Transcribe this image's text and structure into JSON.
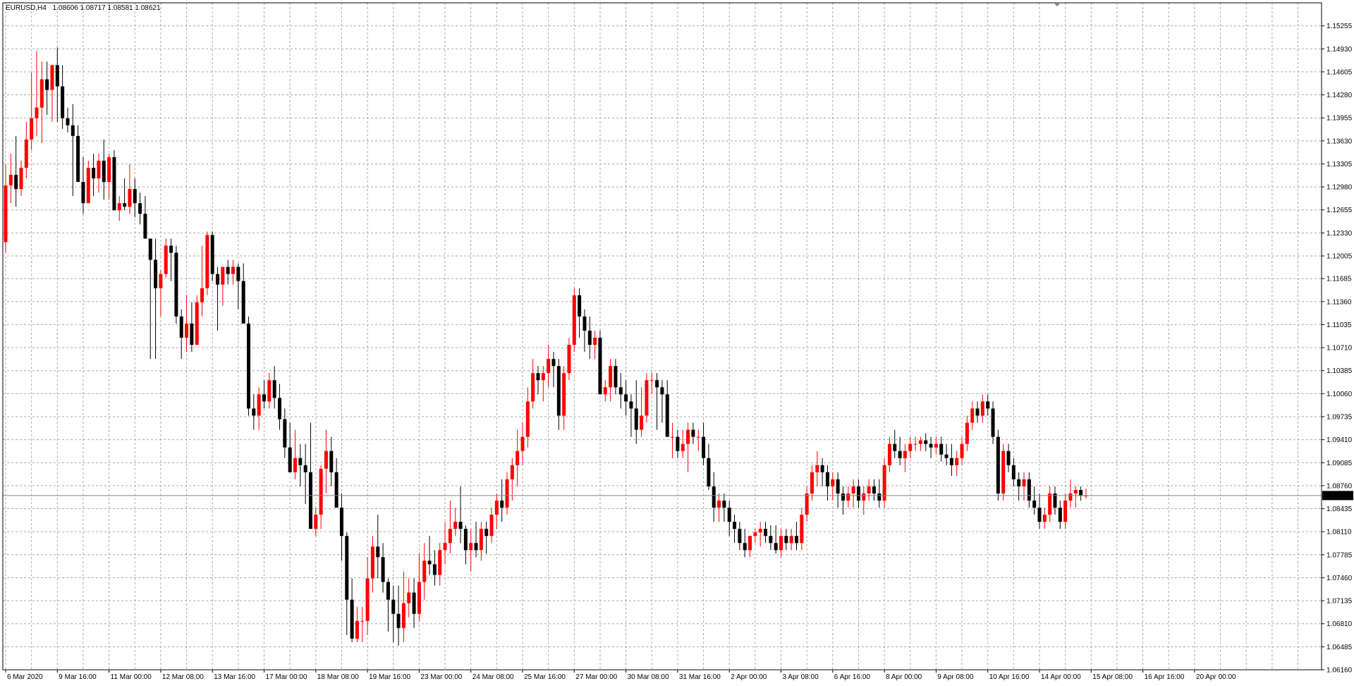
{
  "header": {
    "symbol_tf": "EURUSD,H4",
    "quote": "1.08606 1.08717 1.08581 1.08621"
  },
  "current_price": {
    "label": "1.08621",
    "value": 1.08621,
    "bg": "#000000",
    "fg": "#ffffff",
    "line_color": "#778899"
  },
  "colors": {
    "bull": "#ff0000",
    "bear": "#000000",
    "doji": "#00ff00",
    "grid": "#a9a9a9",
    "background": "#ffffff",
    "frame": "#000000"
  },
  "chart_data": {
    "type": "candlestick",
    "symbol": "EURUSD",
    "timeframe": "H4",
    "ylim": [
      1.0616,
      1.1558
    ],
    "grid": true,
    "y_ticks": [
      "1.15255",
      "1.14930",
      "1.14605",
      "1.14280",
      "1.13955",
      "1.13630",
      "1.13305",
      "1.12980",
      "1.12655",
      "1.12330",
      "1.12005",
      "1.11685",
      "1.11360",
      "1.11035",
      "1.10710",
      "1.10385",
      "1.10060",
      "1.09735",
      "1.09410",
      "1.09085",
      "1.08760",
      "1.08435",
      "1.08110",
      "1.07785",
      "1.07460",
      "1.07135",
      "1.06810",
      "1.06485",
      "1.06160"
    ],
    "x_ticks": [
      "6 Mar 2020",
      "9 Mar 16:00",
      "11 Mar 00:00",
      "12 Mar 08:00",
      "13 Mar 16:00",
      "17 Mar 00:00",
      "18 Mar 08:00",
      "19 Mar 16:00",
      "23 Mar 00:00",
      "24 Mar 08:00",
      "25 Mar 16:00",
      "27 Mar 00:00",
      "30 Mar 08:00",
      "31 Mar 16:00",
      "2 Apr 00:00",
      "3 Apr 08:00",
      "6 Apr 16:00",
      "8 Apr 00:00",
      "9 Apr 08:00",
      "10 Apr 16:00",
      "14 Apr 00:00",
      "15 Apr 08:00",
      "16 Apr 16:00",
      "20 Apr 00:00"
    ],
    "x_tick_index": [
      0,
      10,
      20,
      30,
      40,
      50,
      60,
      70,
      80,
      90,
      100,
      110,
      120,
      130,
      140,
      150,
      160,
      170,
      180,
      190,
      200,
      210,
      220,
      230
    ],
    "candles": [
      [
        1.122,
        1.133,
        1.1205,
        1.13
      ],
      [
        1.13,
        1.1345,
        1.1275,
        1.1315
      ],
      [
        1.1315,
        1.137,
        1.127,
        1.1295
      ],
      [
        1.1295,
        1.1335,
        1.1285,
        1.1325
      ],
      [
        1.1325,
        1.139,
        1.131,
        1.1365
      ],
      [
        1.1365,
        1.146,
        1.135,
        1.1395
      ],
      [
        1.1395,
        1.149,
        1.137,
        1.141
      ],
      [
        1.141,
        1.1475,
        1.136,
        1.145
      ],
      [
        1.145,
        1.1475,
        1.14,
        1.1435
      ],
      [
        1.1435,
        1.1465,
        1.139,
        1.147
      ],
      [
        1.147,
        1.1495,
        1.139,
        1.144
      ],
      [
        1.144,
        1.147,
        1.138,
        1.1395
      ],
      [
        1.1395,
        1.141,
        1.1375,
        1.1385
      ],
      [
        1.1385,
        1.1415,
        1.1285,
        1.137
      ],
      [
        1.137,
        1.1385,
        1.133,
        1.1305
      ],
      [
        1.1305,
        1.134,
        1.126,
        1.1275
      ],
      [
        1.1275,
        1.1335,
        1.128,
        1.1325
      ],
      [
        1.1325,
        1.1345,
        1.1285,
        1.131
      ],
      [
        1.131,
        1.1345,
        1.129,
        1.1335
      ],
      [
        1.1335,
        1.1365,
        1.128,
        1.1305
      ],
      [
        1.1305,
        1.1345,
        1.128,
        1.134
      ],
      [
        1.134,
        1.135,
        1.1265,
        1.1265
      ],
      [
        1.1265,
        1.1285,
        1.125,
        1.1275
      ],
      [
        1.1275,
        1.131,
        1.1265,
        1.127
      ],
      [
        1.127,
        1.133,
        1.126,
        1.1295
      ],
      [
        1.1295,
        1.131,
        1.1255,
        1.1275
      ],
      [
        1.1275,
        1.129,
        1.1245,
        1.126
      ],
      [
        1.126,
        1.1285,
        1.1225,
        1.1225
      ],
      [
        1.1225,
        1.122,
        1.1055,
        1.1195
      ],
      [
        1.1195,
        1.1225,
        1.1055,
        1.1155
      ],
      [
        1.1155,
        1.118,
        1.1115,
        1.1175
      ],
      [
        1.1175,
        1.1225,
        1.117,
        1.1215
      ],
      [
        1.1215,
        1.1225,
        1.1165,
        1.1205
      ],
      [
        1.1205,
        1.1215,
        1.1105,
        1.1115
      ],
      [
        1.1115,
        1.1125,
        1.1055,
        1.1085
      ],
      [
        1.1085,
        1.1145,
        1.1065,
        1.1105
      ],
      [
        1.1105,
        1.1135,
        1.1065,
        1.1075
      ],
      [
        1.1075,
        1.1145,
        1.1075,
        1.1135
      ],
      [
        1.1135,
        1.1215,
        1.1115,
        1.1155
      ],
      [
        1.1155,
        1.1235,
        1.1145,
        1.123
      ],
      [
        1.123,
        1.1235,
        1.1165,
        1.1175
      ],
      [
        1.1175,
        1.1185,
        1.1095,
        1.116
      ],
      [
        1.116,
        1.1185,
        1.113,
        1.1185
      ],
      [
        1.1185,
        1.1195,
        1.116,
        1.1175
      ],
      [
        1.1175,
        1.1195,
        1.116,
        1.1185
      ],
      [
        1.1185,
        1.119,
        1.1125,
        1.1165
      ],
      [
        1.1165,
        1.119,
        1.1135,
        1.1105
      ],
      [
        1.1105,
        1.1115,
        1.0975,
        1.0985
      ],
      [
        1.0985,
        1.1005,
        1.0955,
        1.0975
      ],
      [
        1.0975,
        1.1015,
        1.0955,
        1.1005
      ],
      [
        1.1005,
        1.1025,
        1.0985,
        1.0995
      ],
      [
        1.0995,
        1.1035,
        1.0985,
        1.1025
      ],
      [
        1.1025,
        1.1045,
        1.0985,
        1.1
      ],
      [
        1.1,
        1.102,
        1.0955,
        1.097
      ],
      [
        1.097,
        1.0985,
        1.0915,
        1.093
      ],
      [
        1.093,
        1.0965,
        1.0915,
        1.0895
      ],
      [
        1.0895,
        1.0955,
        1.0885,
        1.0915
      ],
      [
        1.0915,
        1.0935,
        1.0875,
        1.0905
      ],
      [
        1.0905,
        1.0935,
        1.085,
        1.0895
      ],
      [
        1.0895,
        1.0965,
        1.083,
        1.0815
      ],
      [
        1.0815,
        1.0845,
        1.0805,
        1.0835
      ],
      [
        1.0835,
        1.0905,
        1.0815,
        1.09
      ],
      [
        1.09,
        1.0955,
        1.0865,
        1.0925
      ],
      [
        1.0925,
        1.0945,
        1.0875,
        1.0895
      ],
      [
        1.0895,
        1.0915,
        1.0855,
        1.0845
      ],
      [
        1.0845,
        1.0865,
        1.077,
        1.0805
      ],
      [
        1.0805,
        1.081,
        1.0665,
        1.0715
      ],
      [
        1.0715,
        1.0745,
        1.0655,
        1.066
      ],
      [
        1.066,
        1.0705,
        1.0655,
        1.0685
      ],
      [
        1.0685,
        1.0705,
        1.0655,
        1.0685
      ],
      [
        1.0685,
        1.0775,
        1.0665,
        1.0745
      ],
      [
        1.0745,
        1.0805,
        1.0725,
        1.079
      ],
      [
        1.079,
        1.0835,
        1.0745,
        1.0775
      ],
      [
        1.0775,
        1.0795,
        1.0725,
        1.074
      ],
      [
        1.074,
        1.0745,
        1.067,
        1.0715
      ],
      [
        1.0715,
        1.0735,
        1.0655,
        1.0695
      ],
      [
        1.0695,
        1.0735,
        1.065,
        1.0675
      ],
      [
        1.0675,
        1.0755,
        1.0655,
        1.071
      ],
      [
        1.071,
        1.0745,
        1.069,
        1.0725
      ],
      [
        1.0725,
        1.0745,
        1.0675,
        1.0695
      ],
      [
        1.0695,
        1.078,
        1.0685,
        1.074
      ],
      [
        1.074,
        1.0795,
        1.0715,
        1.077
      ],
      [
        1.077,
        1.0805,
        1.075,
        1.0765
      ],
      [
        1.0765,
        1.0785,
        1.0735,
        1.075
      ],
      [
        1.075,
        1.0795,
        1.0735,
        1.0785
      ],
      [
        1.0785,
        1.0825,
        1.0765,
        1.0795
      ],
      [
        1.0795,
        1.0855,
        1.078,
        1.0815
      ],
      [
        1.0815,
        1.0845,
        1.0805,
        1.0825
      ],
      [
        1.0825,
        1.0875,
        1.0795,
        1.0815
      ],
      [
        1.0815,
        1.082,
        1.0765,
        1.0785
      ],
      [
        1.0785,
        1.0815,
        1.0755,
        1.0795
      ],
      [
        1.0795,
        1.0825,
        1.0775,
        1.0785
      ],
      [
        1.0785,
        1.0825,
        1.077,
        1.0815
      ],
      [
        1.0815,
        1.0825,
        1.078,
        1.0805
      ],
      [
        1.0805,
        1.0845,
        1.0795,
        1.0835
      ],
      [
        1.0835,
        1.0865,
        1.0815,
        1.0855
      ],
      [
        1.0855,
        1.0885,
        1.0825,
        1.0845
      ],
      [
        1.0845,
        1.0895,
        1.0835,
        1.0885
      ],
      [
        1.0885,
        1.0915,
        1.0855,
        1.0905
      ],
      [
        1.0905,
        1.0955,
        1.0875,
        1.0925
      ],
      [
        1.0925,
        1.0965,
        1.0905,
        1.0945
      ],
      [
        1.0945,
        1.1015,
        1.093,
        1.0995
      ],
      [
        1.0995,
        1.1055,
        1.0985,
        1.1035
      ],
      [
        1.1035,
        1.1045,
        1.1005,
        1.1025
      ],
      [
        1.1025,
        1.1045,
        1.0995,
        1.1035
      ],
      [
        1.1035,
        1.1075,
        1.1015,
        1.1055
      ],
      [
        1.1055,
        1.1065,
        1.1015,
        1.1045
      ],
      [
        1.1045,
        1.1055,
        1.0955,
        1.0975
      ],
      [
        1.0975,
        1.1045,
        1.0955,
        1.1035
      ],
      [
        1.1035,
        1.1085,
        1.1025,
        1.1075
      ],
      [
        1.1075,
        1.1155,
        1.1065,
        1.1145
      ],
      [
        1.1145,
        1.1155,
        1.1085,
        1.1115
      ],
      [
        1.1115,
        1.1125,
        1.1065,
        1.1095
      ],
      [
        1.1095,
        1.1115,
        1.1055,
        1.1075
      ],
      [
        1.1075,
        1.1095,
        1.1055,
        1.1085
      ],
      [
        1.1085,
        1.1095,
        1.1045,
        1.1005
      ],
      [
        1.1005,
        1.1025,
        1.0995,
        1.1015
      ],
      [
        1.1015,
        1.1055,
        1.0995,
        1.1045
      ],
      [
        1.1045,
        1.1055,
        1.1005,
        1.1015
      ],
      [
        1.1015,
        1.1035,
        1.0985,
        1.1005
      ],
      [
        1.1005,
        1.1025,
        1.0975,
        1.0995
      ],
      [
        1.0995,
        1.1005,
        1.0945,
        1.0985
      ],
      [
        1.0985,
        1.1025,
        1.0935,
        1.0955
      ],
      [
        1.0955,
        1.1015,
        1.0945,
        1.0975
      ],
      [
        1.0975,
        1.1035,
        1.0965,
        1.1025
      ],
      [
        1.1025,
        1.1035,
        1.1005,
        1.1025
      ],
      [
        1.1025,
        1.1035,
        1.0955,
        1.1015
      ],
      [
        1.1015,
        1.1025,
        1.0965,
        1.1005
      ],
      [
        1.1005,
        1.1025,
        1.0945,
        1.0945
      ],
      [
        1.0945,
        1.0965,
        1.0915,
        1.0945
      ],
      [
        1.0945,
        1.0955,
        1.0915,
        1.0925
      ],
      [
        1.0925,
        1.0955,
        1.0915,
        1.0935
      ],
      [
        1.0935,
        1.0965,
        1.0895,
        1.0955
      ],
      [
        1.0955,
        1.0965,
        1.0935,
        1.0945
      ],
      [
        1.0945,
        1.0955,
        1.0925,
        1.0945
      ],
      [
        1.0945,
        1.0965,
        1.0905,
        1.0915
      ],
      [
        1.0915,
        1.0935,
        1.087,
        1.0875
      ],
      [
        1.0875,
        1.0895,
        1.0825,
        1.0845
      ],
      [
        1.0845,
        1.0865,
        1.0825,
        1.0855
      ],
      [
        1.0855,
        1.0865,
        1.0825,
        1.0845
      ],
      [
        1.0845,
        1.0855,
        1.0805,
        1.0825
      ],
      [
        1.0825,
        1.0835,
        1.0795,
        1.0815
      ],
      [
        1.0815,
        1.0825,
        1.0785,
        1.0795
      ],
      [
        1.0795,
        1.0815,
        1.0775,
        1.0785
      ],
      [
        1.0785,
        1.0805,
        1.0775,
        1.0805
      ],
      [
        1.0805,
        1.0815,
        1.0795,
        1.081
      ],
      [
        1.081,
        1.0825,
        1.079,
        1.0815
      ],
      [
        1.0815,
        1.0825,
        1.0795,
        1.0805
      ],
      [
        1.0805,
        1.082,
        1.0785,
        1.0795
      ],
      [
        1.0795,
        1.082,
        1.078,
        1.0785
      ],
      [
        1.0785,
        1.0815,
        1.0775,
        1.0805
      ],
      [
        1.0805,
        1.0815,
        1.0785,
        1.0795
      ],
      [
        1.0795,
        1.0815,
        1.0785,
        1.0805
      ],
      [
        1.0805,
        1.0825,
        1.0785,
        1.0795
      ],
      [
        1.0795,
        1.0845,
        1.0785,
        1.0835
      ],
      [
        1.0835,
        1.0875,
        1.0825,
        1.0865
      ],
      [
        1.0865,
        1.0905,
        1.0855,
        1.0895
      ],
      [
        1.0895,
        1.0925,
        1.0875,
        1.0905
      ],
      [
        1.0905,
        1.0915,
        1.0875,
        1.0895
      ],
      [
        1.0895,
        1.0905,
        1.0855,
        1.0875
      ],
      [
        1.0875,
        1.0895,
        1.0855,
        1.0885
      ],
      [
        1.0885,
        1.0895,
        1.0845,
        1.0865
      ],
      [
        1.0865,
        1.0875,
        1.0835,
        1.0855
      ],
      [
        1.0855,
        1.0875,
        1.0845,
        1.0865
      ],
      [
        1.0865,
        1.0885,
        1.0845,
        1.0875
      ],
      [
        1.0875,
        1.0885,
        1.0845,
        1.0855
      ],
      [
        1.0855,
        1.0875,
        1.0835,
        1.0865
      ],
      [
        1.0865,
        1.0885,
        1.0855,
        1.0875
      ],
      [
        1.0875,
        1.0885,
        1.0855,
        1.0865
      ],
      [
        1.0865,
        1.0885,
        1.0845,
        1.0855
      ],
      [
        1.0855,
        1.0915,
        1.0845,
        1.0905
      ],
      [
        1.0905,
        1.0945,
        1.0895,
        1.0935
      ],
      [
        1.0935,
        1.0955,
        1.0915,
        1.0925
      ],
      [
        1.0925,
        1.0945,
        1.0905,
        1.0915
      ],
      [
        1.0915,
        1.0935,
        1.0895,
        1.0925
      ],
      [
        1.0925,
        1.0945,
        1.0915,
        1.0935
      ],
      [
        1.0935,
        1.0945,
        1.0925,
        1.0935
      ],
      [
        1.0935,
        1.0945,
        1.0925,
        1.094
      ],
      [
        1.094,
        1.095,
        1.0925,
        1.0935
      ],
      [
        1.0935,
        1.0945,
        1.0915,
        1.093
      ],
      [
        1.093,
        1.0945,
        1.092,
        1.0935
      ],
      [
        1.0935,
        1.0945,
        1.091,
        1.092
      ],
      [
        1.092,
        1.0935,
        1.0905,
        1.0915
      ],
      [
        1.0915,
        1.0935,
        1.089,
        1.0905
      ],
      [
        1.0905,
        1.0925,
        1.089,
        1.0915
      ],
      [
        1.0915,
        1.0945,
        1.0905,
        1.0935
      ],
      [
        1.0935,
        1.0975,
        1.0925,
        1.0965
      ],
      [
        1.0965,
        1.0995,
        1.0955,
        1.0985
      ],
      [
        1.0985,
        1.0995,
        1.0965,
        1.0975
      ],
      [
        1.0975,
        1.1005,
        1.0965,
        1.0995
      ],
      [
        1.0995,
        1.1005,
        1.0975,
        1.0985
      ],
      [
        1.0985,
        1.0995,
        1.0935,
        1.0945
      ],
      [
        1.0945,
        1.0955,
        1.0855,
        1.0865
      ],
      [
        1.0865,
        1.0935,
        1.0855,
        1.0925
      ],
      [
        1.0925,
        1.0935,
        1.0895,
        1.0905
      ],
      [
        1.0905,
        1.0915,
        1.0875,
        1.0885
      ],
      [
        1.0885,
        1.0895,
        1.0855,
        1.0875
      ],
      [
        1.0875,
        1.0895,
        1.0855,
        1.0885
      ],
      [
        1.0885,
        1.0895,
        1.0845,
        1.0855
      ],
      [
        1.0855,
        1.0875,
        1.0835,
        1.0845
      ],
      [
        1.0845,
        1.0865,
        1.0815,
        1.0825
      ],
      [
        1.0825,
        1.0845,
        1.0815,
        1.0835
      ],
      [
        1.0835,
        1.0875,
        1.0825,
        1.0865
      ],
      [
        1.0865,
        1.0875,
        1.0835,
        1.0845
      ],
      [
        1.0845,
        1.0855,
        1.0815,
        1.0825
      ],
      [
        1.0825,
        1.0865,
        1.0815,
        1.0855
      ],
      [
        1.0855,
        1.0885,
        1.0845,
        1.0865
      ],
      [
        1.0865,
        1.0875,
        1.0845,
        1.087
      ],
      [
        1.087,
        1.0875,
        1.0855,
        1.0862
      ],
      [
        1.0862,
        1.0872,
        1.0858,
        1.0862
      ]
    ]
  }
}
